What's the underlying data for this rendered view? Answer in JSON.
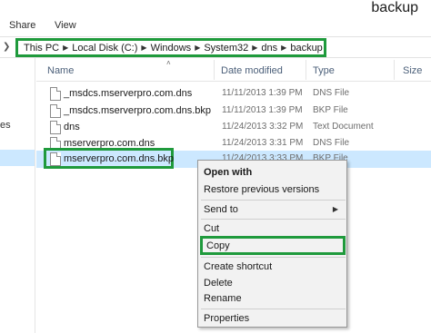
{
  "window": {
    "title": "backup"
  },
  "ribbon": {
    "tabs": [
      "Share",
      "View"
    ]
  },
  "address": {
    "crumbs": [
      "This PC",
      "Local Disk (C:)",
      "Windows",
      "System32",
      "dns",
      "backup"
    ]
  },
  "sidebar": {
    "partial_text": "es"
  },
  "columns": {
    "name": "Name",
    "date": "Date modified",
    "type": "Type",
    "size": "Size"
  },
  "files": [
    {
      "name": "_msdcs.mserverpro.com.dns",
      "date": "11/11/2013 1:39 PM",
      "type": "DNS File"
    },
    {
      "name": "_msdcs.mserverpro.com.dns.bkp",
      "date": "11/11/2013 1:39 PM",
      "type": "BKP File"
    },
    {
      "name": "dns",
      "date": "11/24/2013 3:32 PM",
      "type": "Text Document"
    },
    {
      "name": "mserverpro.com.dns",
      "date": "11/24/2013 3:31 PM",
      "type": "DNS File"
    },
    {
      "name": "mserverpro.com.dns.bkp",
      "date": "11/24/2013 3:33 PM",
      "type": "BKP File"
    }
  ],
  "context_menu": {
    "open_with": "Open with",
    "restore": "Restore previous versions",
    "send_to": "Send to",
    "cut": "Cut",
    "copy": "Copy",
    "create_shortcut": "Create shortcut",
    "delete": "Delete",
    "rename": "Rename",
    "properties": "Properties"
  },
  "colors": {
    "highlight_outline": "#1f9a3c",
    "selection": "#cce8ff"
  }
}
